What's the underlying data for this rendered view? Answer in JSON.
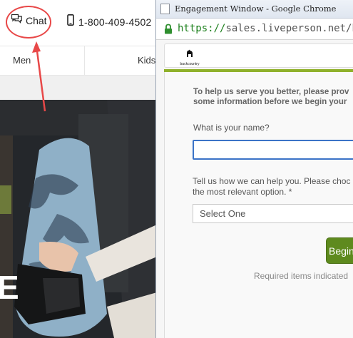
{
  "site": {
    "chat_label": "Chat",
    "phone": "1-800-409-4502",
    "nav": {
      "men": "Men",
      "kids": "Kids"
    },
    "hero_text": "E"
  },
  "popup": {
    "window_title": "Engagement Window - Google Chrome",
    "url_scheme": "https://",
    "url_rest": "sales.liveperson.net/hc",
    "brand_name": "backcountry",
    "intro_line1": "To help us serve you better, please prov",
    "intro_line2": "some information before we begin your",
    "name_question": "What is your name?",
    "name_value": "",
    "help_line1": "Tell us how we can help you. Please choc",
    "help_line2": "the most relevant option. *",
    "select_value": "Select One",
    "begin_label": "Begin",
    "required_note": "Required items indicated"
  },
  "colors": {
    "annotation": "#e84848",
    "accent_green": "#8fb12b",
    "button_green": "#5e8a1e",
    "url_green": "#1a7f1a",
    "focus_blue": "#3b73c7"
  },
  "icons": {
    "chat": "chat-bubbles-icon",
    "phone": "mobile-phone-icon",
    "page": "page-icon",
    "lock": "lock-icon",
    "brand": "goat-logo-icon"
  }
}
